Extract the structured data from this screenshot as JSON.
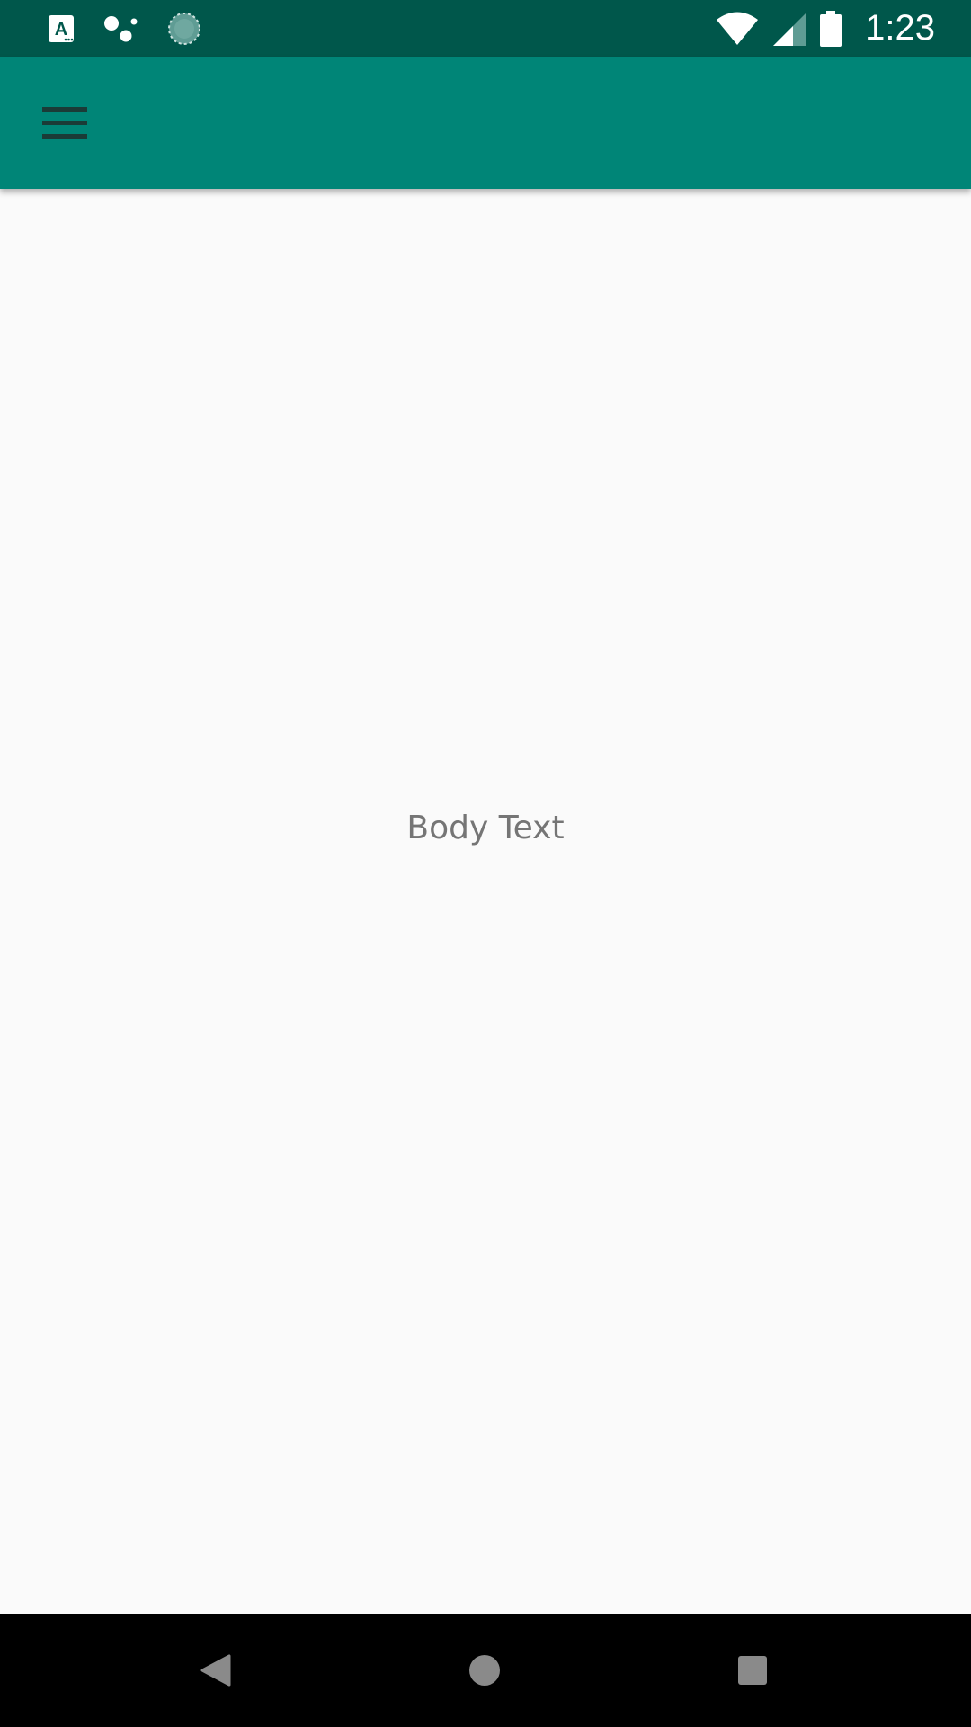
{
  "status_bar": {
    "time": "1:23",
    "background": "#00574b",
    "icons_left": [
      "app-a-icon",
      "assistant-dots-icon",
      "loading-spinner-icon"
    ],
    "icons_right": [
      "wifi-icon",
      "cell-signal-icon",
      "battery-icon"
    ]
  },
  "app_bar": {
    "background": "#008577",
    "menu_icon": "hamburger-menu-icon"
  },
  "main": {
    "body_text": "Body Text"
  },
  "nav_bar": {
    "buttons": [
      "back-icon",
      "home-icon",
      "recents-icon"
    ]
  }
}
